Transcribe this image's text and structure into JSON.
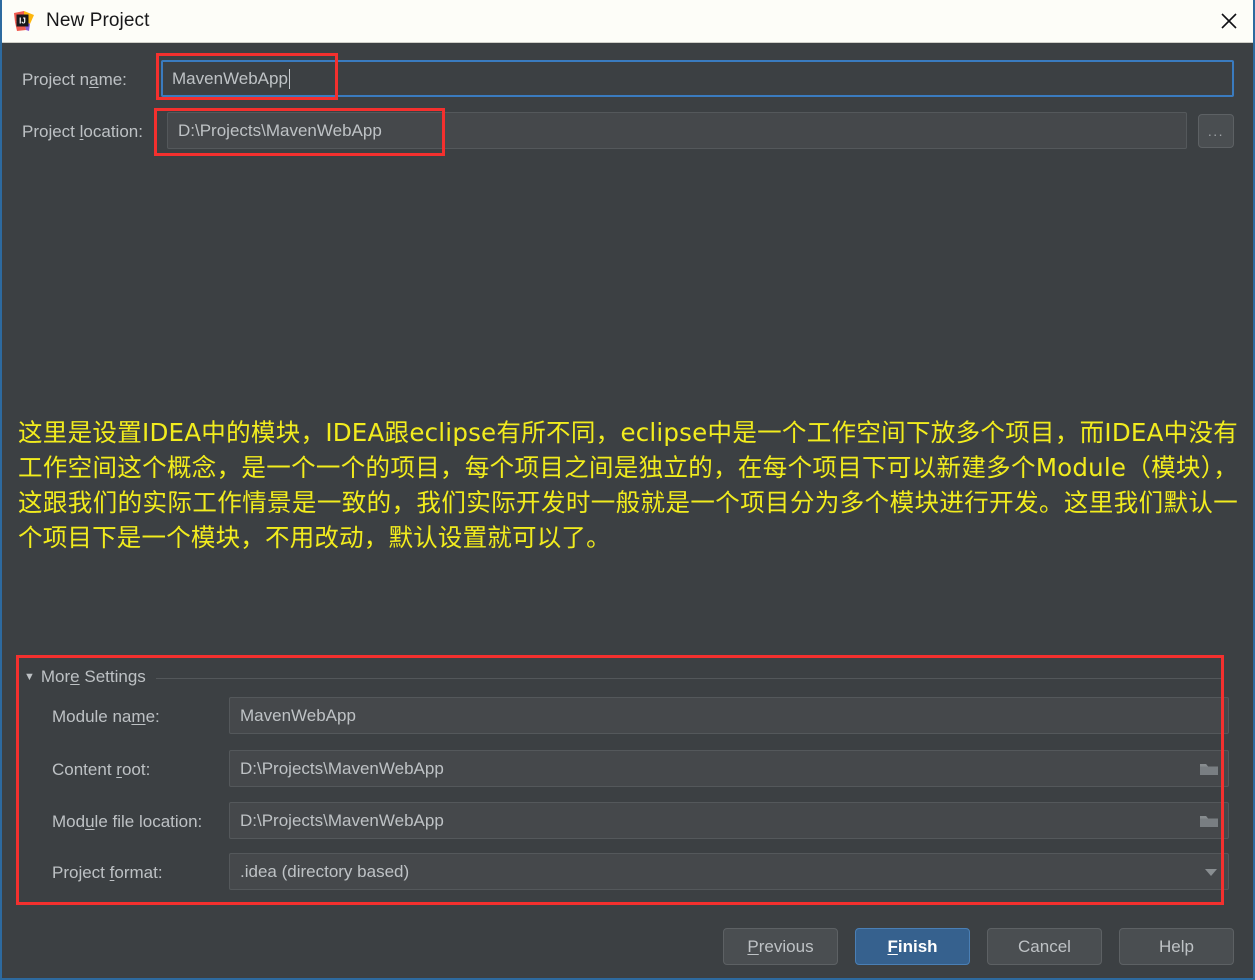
{
  "window": {
    "title": "New Project",
    "logo_icon": "intellij-idea-logo",
    "close_icon": "close-icon",
    "accent_border": "#2d6a9f",
    "background": "#3c4043"
  },
  "form": {
    "project_name": {
      "label_pre": "Project n",
      "label_accel": "a",
      "label_post": "me:",
      "value": "MavenWebApp",
      "focused": true
    },
    "project_location": {
      "label_pre": "Project ",
      "label_accel": "l",
      "label_post": "ocation:",
      "value": "D:\\Projects\\MavenWebApp"
    },
    "browse_button": {
      "label": "...",
      "icon": "ellipsis-icon"
    }
  },
  "annotation": {
    "color": "#f2ec1e",
    "text": "这里是设置IDEA中的模块，IDEA跟eclipse有所不同，eclipse中是一个工作空间下放多个项目，而IDEA中没有工作空间这个概念，是一个一个的项目，每个项目之间是独立的，在每个项目下可以新建多个Module（模块），这跟我们的实际工作情景是一致的，我们实际开发时一般就是一个项目分为多个模块进行开发。这里我们默认一个项目下是一个模块，不用改动，默认设置就可以了。"
  },
  "more_settings": {
    "arrow_icon": "triangle-down-icon",
    "label_pre": "Mor",
    "label_accel": "e",
    "label_post": " Settings",
    "expanded": true,
    "fields": [
      {
        "name": "module-name",
        "label_pre": "Module na",
        "label_accel": "m",
        "label_post": "e:",
        "value": "MavenWebApp",
        "icon": ""
      },
      {
        "name": "content-root",
        "label_pre": "Content ",
        "label_accel": "r",
        "label_post": "oot:",
        "value": "D:\\Projects\\MavenWebApp",
        "icon": "folder-icon"
      },
      {
        "name": "module-file-location",
        "label_pre": "Mod",
        "label_accel": "u",
        "label_post": "le file location:",
        "value": "D:\\Projects\\MavenWebApp",
        "icon": "folder-icon"
      },
      {
        "name": "project-format",
        "label_pre": "Project ",
        "label_accel": "f",
        "label_post": "ormat:",
        "value": ".idea (directory based)",
        "icon": "chevron-down-icon"
      }
    ]
  },
  "buttons": {
    "previous": {
      "pre": "",
      "accel": "P",
      "post": "revious"
    },
    "finish": {
      "pre": "",
      "accel": "F",
      "post": "inish",
      "primary": true,
      "color": "#36618e"
    },
    "cancel": {
      "pre": "Cancel",
      "accel": "",
      "post": ""
    },
    "help": {
      "pre": "Help",
      "accel": "",
      "post": ""
    }
  },
  "highlight_boxes": {
    "color": "#f4302e",
    "regions": [
      "project-name-field",
      "project-location-field",
      "more-settings-panel"
    ]
  }
}
